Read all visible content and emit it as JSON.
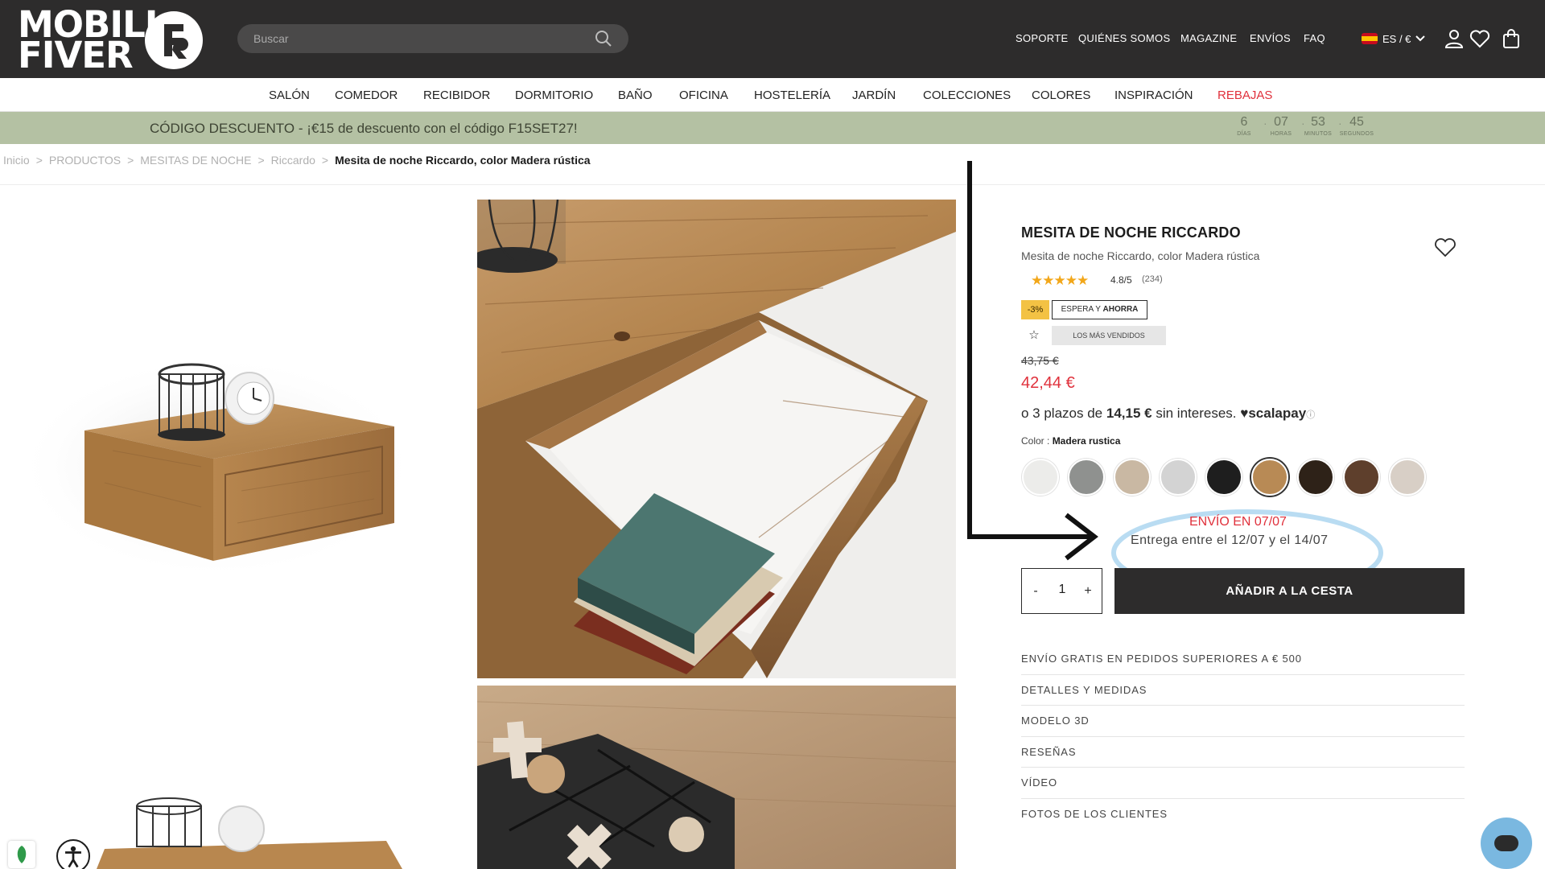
{
  "brand": {
    "line1": "MOBILI",
    "line2": "FIVER"
  },
  "search": {
    "placeholder": "Buscar"
  },
  "top_nav": [
    "SOPORTE",
    "QUIÉNES SOMOS",
    "MAGAZINE",
    "ENVÍOS",
    "FAQ"
  ],
  "language": {
    "label": "ES / €"
  },
  "categories": [
    "SALÓN",
    "COMEDOR",
    "RECIBIDOR",
    "DORMITORIO",
    "BAÑO",
    "OFICINA",
    "HOSTELERÍA",
    "JARDÍN",
    "COLECCIONES",
    "COLORES",
    "INSPIRACIÓN",
    "REBAJAS"
  ],
  "promo": {
    "message": "CÓDIGO DESCUENTO - ¡€15 de descuento con el código F15SET27!",
    "countdown": [
      {
        "value": "6",
        "label": "DÍAS"
      },
      {
        "value": "07",
        "label": "HORAS"
      },
      {
        "value": "53",
        "label": "MINUTOS"
      },
      {
        "value": "45",
        "label": "SEGUNDOS"
      }
    ]
  },
  "breadcrumb": {
    "items": [
      "Inicio",
      "PRODUCTOS",
      "MESITAS DE NOCHE",
      "Riccardo"
    ],
    "current": "Mesita de noche Riccardo, color Madera rústica"
  },
  "product": {
    "title": "MESITA DE NOCHE RICCARDO",
    "subtitle": "Mesita de noche Riccardo, color Madera rústica",
    "rating": {
      "score": "4.8/5",
      "count": "(234)",
      "stars": 5
    },
    "badges": {
      "discount": "-3%",
      "wait_prefix": "ESPERA Y",
      "wait_strong": "AHORRA",
      "bestseller": "LOS MÁS VENDIDOS"
    },
    "price_old": "43,75 €",
    "price_new": "42,44 €",
    "installments": {
      "prefix": "o 3 plazos de",
      "amount": "14,15 €",
      "suffix": "sin intereses.",
      "provider": "scalapay"
    },
    "color_label": "Color :",
    "color_value": "Madera rustica",
    "swatches": [
      {
        "name": "blanco",
        "color": "#ececea",
        "selected": false
      },
      {
        "name": "cemento",
        "color": "#8f918f",
        "selected": false
      },
      {
        "name": "roble claro",
        "color": "#c9b8a3",
        "selected": false
      },
      {
        "name": "gris claro",
        "color": "#d3d3d3",
        "selected": false
      },
      {
        "name": "negro",
        "color": "#1e1e1e",
        "selected": false
      },
      {
        "name": "madera rustica",
        "color": "#b88a55",
        "selected": true
      },
      {
        "name": "wengué",
        "color": "#2e2218",
        "selected": false
      },
      {
        "name": "nogal",
        "color": "#5e3f2c",
        "selected": false
      },
      {
        "name": "roble blanqueado",
        "color": "#d8cfc6",
        "selected": false
      }
    ],
    "shipping": {
      "title": "ENVÍO EN 07/07",
      "delivery": "Entrega entre el 12/07 y el 14/07"
    },
    "quantity": {
      "minus": "-",
      "value": "1",
      "plus": "+"
    },
    "add_to_cart": "AÑADIR A LA CESTA",
    "accordion": [
      "ENVÍO GRATIS EN PEDIDOS SUPERIORES A € 500",
      "DETALLES Y MEDIDAS",
      "MODELO 3D",
      "RESEÑAS",
      "VÍDEO",
      "FOTOS DE LOS CLIENTES"
    ]
  },
  "colors": {
    "header_bg": "#2d2c2c",
    "promo_bg": "#b4c1a3",
    "sale_red": "#e0313c",
    "star": "#f2a71a",
    "annotation_blue": "#b9dcf2"
  }
}
